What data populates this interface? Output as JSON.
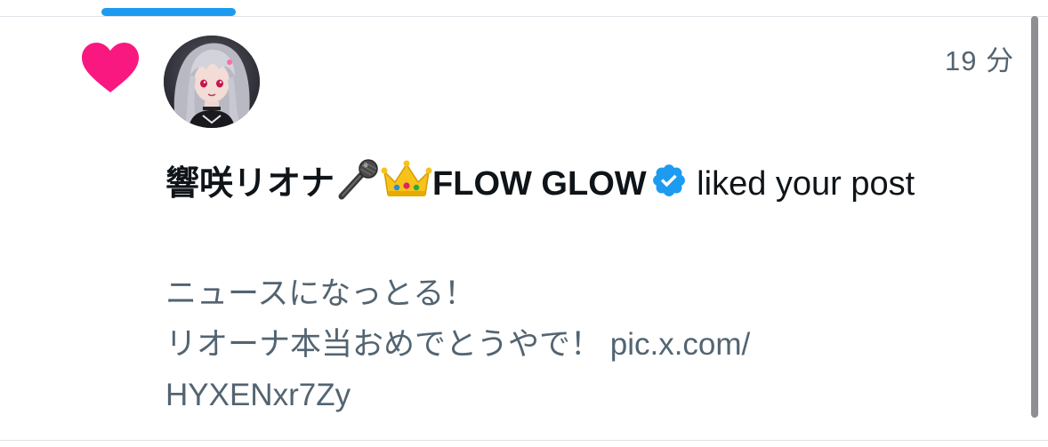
{
  "notification": {
    "time_ago": "19 分",
    "user_name": "響咲リオナ",
    "user_name_suffix": "FLOW GLOW",
    "action_text": " liked your post",
    "post_preview": {
      "line1": "ニュースになっとる！",
      "line2": "リオーナ本当おめでとうやで！ pic.x.com/",
      "line3": "HYXENxr7Zy"
    }
  },
  "icons": {
    "heart": "heart-icon",
    "microphone": "microphone-emoji-icon",
    "crown": "crown-emoji-icon",
    "verified": "verified-badge-icon"
  },
  "colors": {
    "accent": "#1d9bf0",
    "like": "#f91880",
    "text_primary": "#0f1419",
    "text_secondary": "#536471"
  }
}
